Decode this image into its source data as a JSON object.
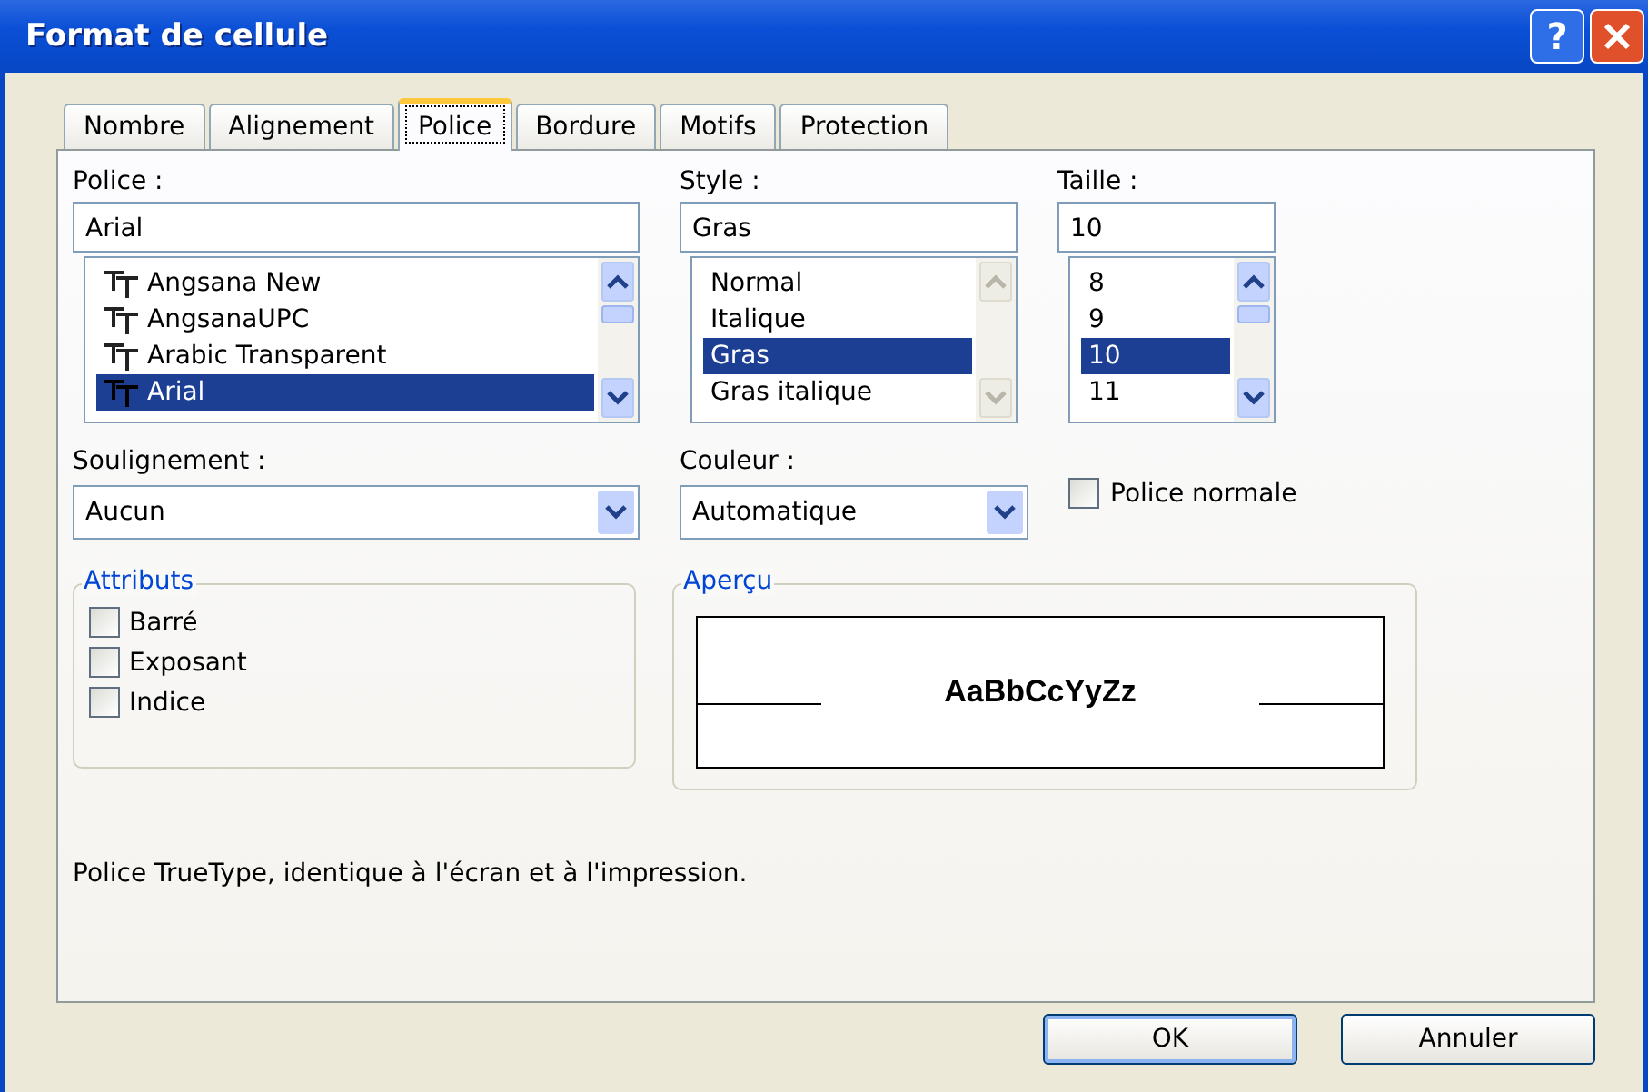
{
  "window": {
    "title": "Format de cellule",
    "help_button": "?"
  },
  "tabs": [
    {
      "label": "Nombre",
      "selected": false
    },
    {
      "label": "Alignement",
      "selected": false
    },
    {
      "label": "Police",
      "selected": true
    },
    {
      "label": "Bordure",
      "selected": false
    },
    {
      "label": "Motifs",
      "selected": false
    },
    {
      "label": "Protection",
      "selected": false
    }
  ],
  "lists": [
    {
      "kind": "font",
      "label": "Police :",
      "value": "Arial",
      "scrollbar_disabled": false,
      "items": [
        {
          "label": "Angsana New",
          "selected": false
        },
        {
          "label": "AngsanaUPC",
          "selected": false
        },
        {
          "label": "Arabic Transparent",
          "selected": false
        },
        {
          "label": "Arial",
          "selected": true
        }
      ]
    },
    {
      "kind": "plain",
      "label": "Style :",
      "value": "Gras",
      "scrollbar_disabled": true,
      "items": [
        {
          "label": "Normal",
          "selected": false
        },
        {
          "label": "Italique",
          "selected": false
        },
        {
          "label": "Gras",
          "selected": true
        },
        {
          "label": "Gras italique",
          "selected": false
        }
      ]
    },
    {
      "kind": "plain",
      "label": "Taille :",
      "value": "10",
      "scrollbar_disabled": false,
      "items": [
        {
          "label": "8",
          "selected": false
        },
        {
          "label": "9",
          "selected": false
        },
        {
          "label": "10",
          "selected": true
        },
        {
          "label": "11",
          "selected": false
        }
      ]
    }
  ],
  "dropdowns": [
    {
      "label": "Soulignement :",
      "value": "Aucun"
    },
    {
      "label": "Couleur :",
      "value": "Automatique"
    }
  ],
  "normal_font": {
    "label": "Police normale",
    "checked": false
  },
  "attributes": {
    "title": "Attributs",
    "items": [
      {
        "label": "Barré",
        "checked": false
      },
      {
        "label": "Exposant",
        "checked": false
      },
      {
        "label": "Indice",
        "checked": false
      }
    ]
  },
  "preview": {
    "title": "Aperçu",
    "sample": "AaBbCcYyZz"
  },
  "description": "Police TrueType, identique à l'écran et à l'impression.",
  "buttons": [
    {
      "label": "OK",
      "default": true
    },
    {
      "label": "Annuler",
      "default": false
    }
  ]
}
